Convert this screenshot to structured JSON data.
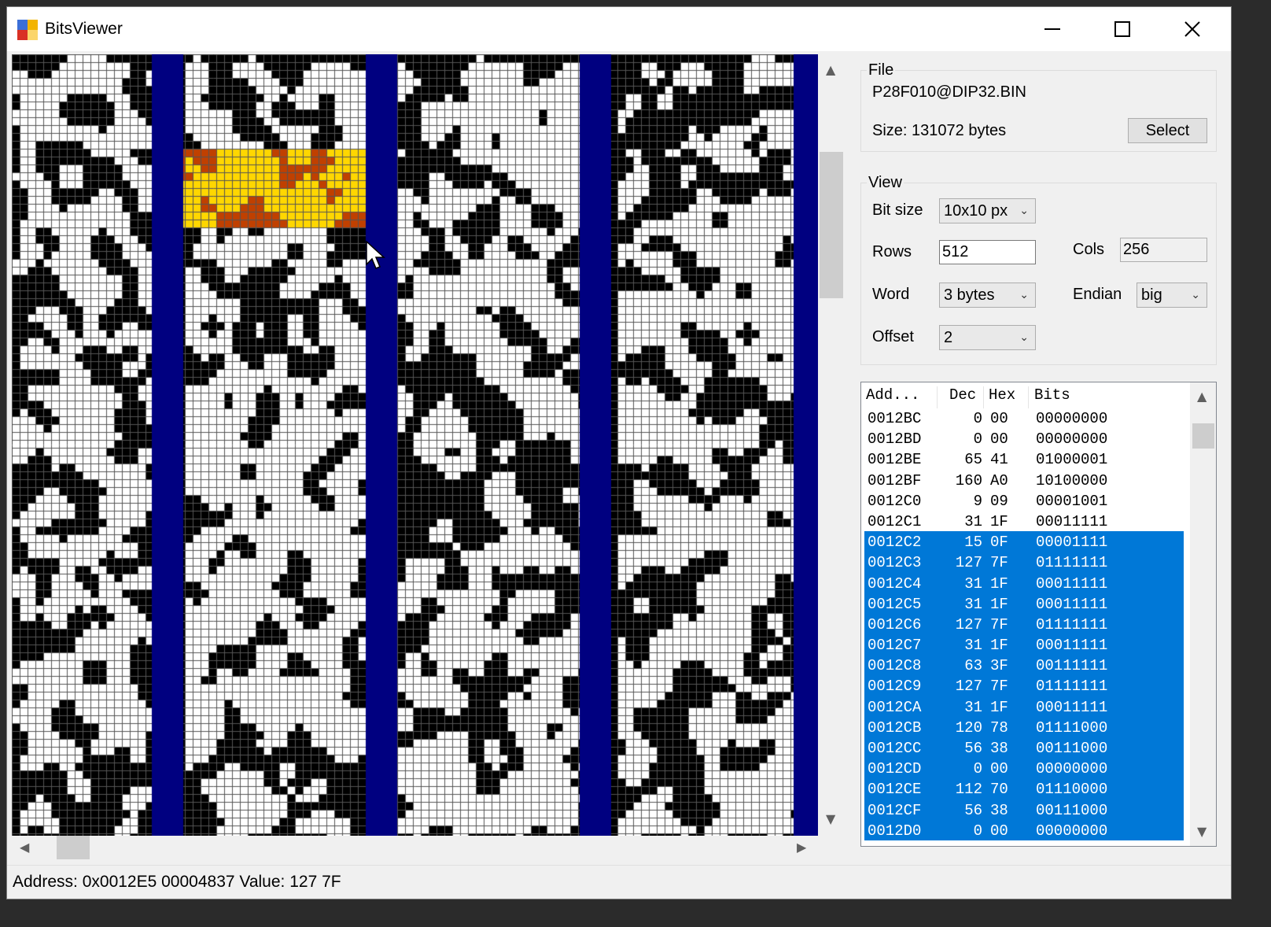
{
  "window": {
    "title": "BitsViewer",
    "icon": "bitsviewer-app-icon",
    "controls": [
      "minimize-icon",
      "maximize-icon",
      "close-icon"
    ]
  },
  "file": {
    "group_label": "File",
    "filename": "P28F010@DIP32.BIN",
    "size_text": "Size: 131072 bytes",
    "select_label": "Select"
  },
  "view": {
    "group_label": "View",
    "bit_size_label": "Bit size",
    "bit_size_value": "10x10 px",
    "rows_label": "Rows",
    "rows_value": "512",
    "cols_label": "Cols",
    "cols_value": "256",
    "word_label": "Word",
    "word_value": "3 bytes",
    "endian_label": "Endian",
    "endian_value": "big",
    "offset_label": "Offset",
    "offset_value": "2"
  },
  "table": {
    "headers": {
      "address": "Add...",
      "dec": "Dec",
      "hex": "Hex",
      "bits": "Bits"
    },
    "rows": [
      {
        "address": "0012BC",
        "dec": "0",
        "hex": "00",
        "bits": "00000000",
        "selected": false
      },
      {
        "address": "0012BD",
        "dec": "0",
        "hex": "00",
        "bits": "00000000",
        "selected": false
      },
      {
        "address": "0012BE",
        "dec": "65",
        "hex": "41",
        "bits": "01000001",
        "selected": false
      },
      {
        "address": "0012BF",
        "dec": "160",
        "hex": "A0",
        "bits": "10100000",
        "selected": false
      },
      {
        "address": "0012C0",
        "dec": "9",
        "hex": "09",
        "bits": "00001001",
        "selected": false
      },
      {
        "address": "0012C1",
        "dec": "31",
        "hex": "1F",
        "bits": "00011111",
        "selected": false
      },
      {
        "address": "0012C2",
        "dec": "15",
        "hex": "0F",
        "bits": "00001111",
        "selected": true
      },
      {
        "address": "0012C3",
        "dec": "127",
        "hex": "7F",
        "bits": "01111111",
        "selected": true
      },
      {
        "address": "0012C4",
        "dec": "31",
        "hex": "1F",
        "bits": "00011111",
        "selected": true
      },
      {
        "address": "0012C5",
        "dec": "31",
        "hex": "1F",
        "bits": "00011111",
        "selected": true
      },
      {
        "address": "0012C6",
        "dec": "127",
        "hex": "7F",
        "bits": "01111111",
        "selected": true
      },
      {
        "address": "0012C7",
        "dec": "31",
        "hex": "1F",
        "bits": "00011111",
        "selected": true
      },
      {
        "address": "0012C8",
        "dec": "63",
        "hex": "3F",
        "bits": "00111111",
        "selected": true
      },
      {
        "address": "0012C9",
        "dec": "127",
        "hex": "7F",
        "bits": "01111111",
        "selected": true
      },
      {
        "address": "0012CA",
        "dec": "31",
        "hex": "1F",
        "bits": "00011111",
        "selected": true
      },
      {
        "address": "0012CB",
        "dec": "120",
        "hex": "78",
        "bits": "01111000",
        "selected": true
      },
      {
        "address": "0012CC",
        "dec": "56",
        "hex": "38",
        "bits": "00111000",
        "selected": true
      },
      {
        "address": "0012CD",
        "dec": "0",
        "hex": "00",
        "bits": "00000000",
        "selected": true
      },
      {
        "address": "0012CE",
        "dec": "112",
        "hex": "70",
        "bits": "01110000",
        "selected": true
      },
      {
        "address": "0012CF",
        "dec": "56",
        "hex": "38",
        "bits": "00111000",
        "selected": true
      },
      {
        "address": "0012D0",
        "dec": "0",
        "hex": "00",
        "bits": "00000000",
        "selected": true
      }
    ]
  },
  "status": {
    "text": "Address: 0x0012E5 00004837  Value: 127 7F"
  },
  "colors": {
    "bit_on": "#ffffff",
    "bit_off": "#000000",
    "grid": "#555555",
    "column_separator": "#000080",
    "highlight_on": "#ffd700",
    "highlight_off": "#c04000",
    "selection": "#0078d7"
  },
  "icons": {
    "scroll_up": "▲",
    "scroll_down": "▼",
    "scroll_left": "◀",
    "scroll_right": "▶",
    "dropdown": "⌄"
  }
}
